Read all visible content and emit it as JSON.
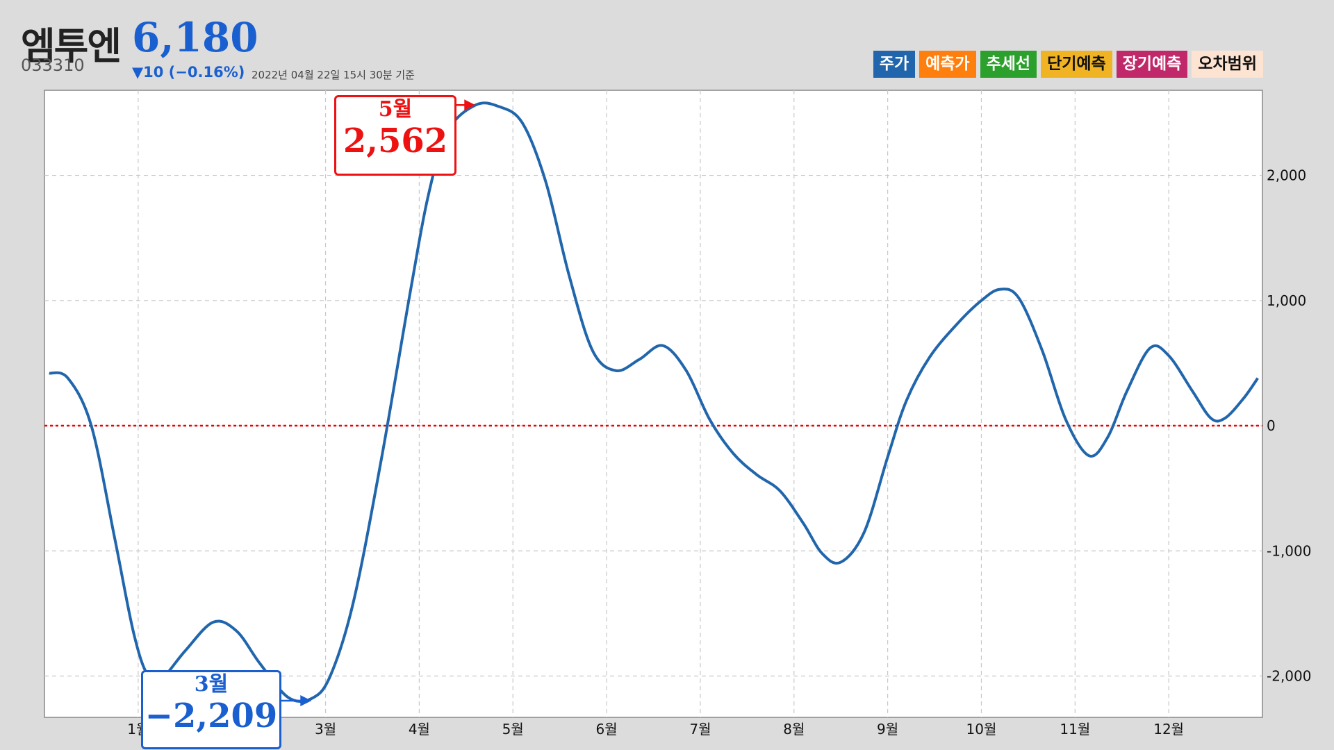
{
  "header": {
    "name": "엠투엔",
    "price": "6,180",
    "code": "033310",
    "change": "▼10 (−0.16%)",
    "timestamp": "2022년 04월 22일 15시 30분 기준"
  },
  "legend": [
    {
      "label": "주가",
      "color": "#2166ac",
      "text": "#ffffff"
    },
    {
      "label": "예측가",
      "color": "#ff7f0e",
      "text": "#ffffff"
    },
    {
      "label": "추세선",
      "color": "#2ca02c",
      "text": "#ffffff"
    },
    {
      "label": "단기예측",
      "color": "#f0b323",
      "text": "#111111"
    },
    {
      "label": "장기예측",
      "color": "#c0286a",
      "text": "#ffffff"
    },
    {
      "label": "오차범위",
      "color": "#fde3d2",
      "text": "#111111"
    }
  ],
  "annotations": {
    "max": {
      "month": "5월",
      "value": "2,562",
      "color": "#ee1111"
    },
    "min": {
      "month": "3월",
      "value": "−2,209",
      "color": "#1a5fd0"
    }
  },
  "chart_data": {
    "type": "line",
    "x_ticks": [
      {
        "label": "1월",
        "x": 1
      },
      {
        "label": "3월",
        "x": 3
      },
      {
        "label": "4월",
        "x": 4
      },
      {
        "label": "5월",
        "x": 5
      },
      {
        "label": "6월",
        "x": 6
      },
      {
        "label": "7월",
        "x": 7
      },
      {
        "label": "8월",
        "x": 8
      },
      {
        "label": "9월",
        "x": 9
      },
      {
        "label": "10월",
        "x": 10
      },
      {
        "label": "11월",
        "x": 11
      },
      {
        "label": "12월",
        "x": 12
      }
    ],
    "y_ticks": [
      {
        "label": "2,000",
        "value": 2000
      },
      {
        "label": "1,000",
        "value": 1000
      },
      {
        "label": "0",
        "value": 0
      },
      {
        "label": "-1,000",
        "value": -1000
      },
      {
        "label": "-2,000",
        "value": -2000
      }
    ],
    "xlim": [
      0,
      13
    ],
    "ylim": [
      -2330,
      2680
    ],
    "grid": true,
    "baseline": 0,
    "series": [
      {
        "color": "#2166ac",
        "points": [
          [
            0.05,
            420
          ],
          [
            0.25,
            380
          ],
          [
            0.5,
            0
          ],
          [
            0.75,
            -900
          ],
          [
            0.95,
            -1650
          ],
          [
            1.1,
            -1990
          ],
          [
            1.25,
            -2020
          ],
          [
            1.5,
            -1800
          ],
          [
            1.8,
            -1570
          ],
          [
            2.05,
            -1640
          ],
          [
            2.3,
            -1900
          ],
          [
            2.6,
            -2170
          ],
          [
            2.85,
            -2180
          ],
          [
            3.05,
            -2000
          ],
          [
            3.3,
            -1400
          ],
          [
            3.6,
            -250
          ],
          [
            3.9,
            1050
          ],
          [
            4.1,
            1850
          ],
          [
            4.3,
            2350
          ],
          [
            4.6,
            2562
          ],
          [
            4.85,
            2550
          ],
          [
            5.1,
            2420
          ],
          [
            5.35,
            1950
          ],
          [
            5.6,
            1200
          ],
          [
            5.85,
            600
          ],
          [
            6.1,
            440
          ],
          [
            6.35,
            530
          ],
          [
            6.6,
            640
          ],
          [
            6.85,
            440
          ],
          [
            7.1,
            50
          ],
          [
            7.35,
            -220
          ],
          [
            7.6,
            -390
          ],
          [
            7.85,
            -520
          ],
          [
            8.1,
            -780
          ],
          [
            8.3,
            -1020
          ],
          [
            8.5,
            -1090
          ],
          [
            8.75,
            -850
          ],
          [
            9.0,
            -250
          ],
          [
            9.2,
            200
          ],
          [
            9.45,
            550
          ],
          [
            9.75,
            820
          ],
          [
            10.0,
            1000
          ],
          [
            10.2,
            1090
          ],
          [
            10.4,
            1020
          ],
          [
            10.65,
            600
          ],
          [
            10.9,
            50
          ],
          [
            11.15,
            -240
          ],
          [
            11.35,
            -90
          ],
          [
            11.55,
            270
          ],
          [
            11.8,
            620
          ],
          [
            12.0,
            560
          ],
          [
            12.25,
            280
          ],
          [
            12.45,
            60
          ],
          [
            12.6,
            60
          ],
          [
            12.8,
            220
          ],
          [
            12.95,
            380
          ]
        ]
      }
    ]
  }
}
